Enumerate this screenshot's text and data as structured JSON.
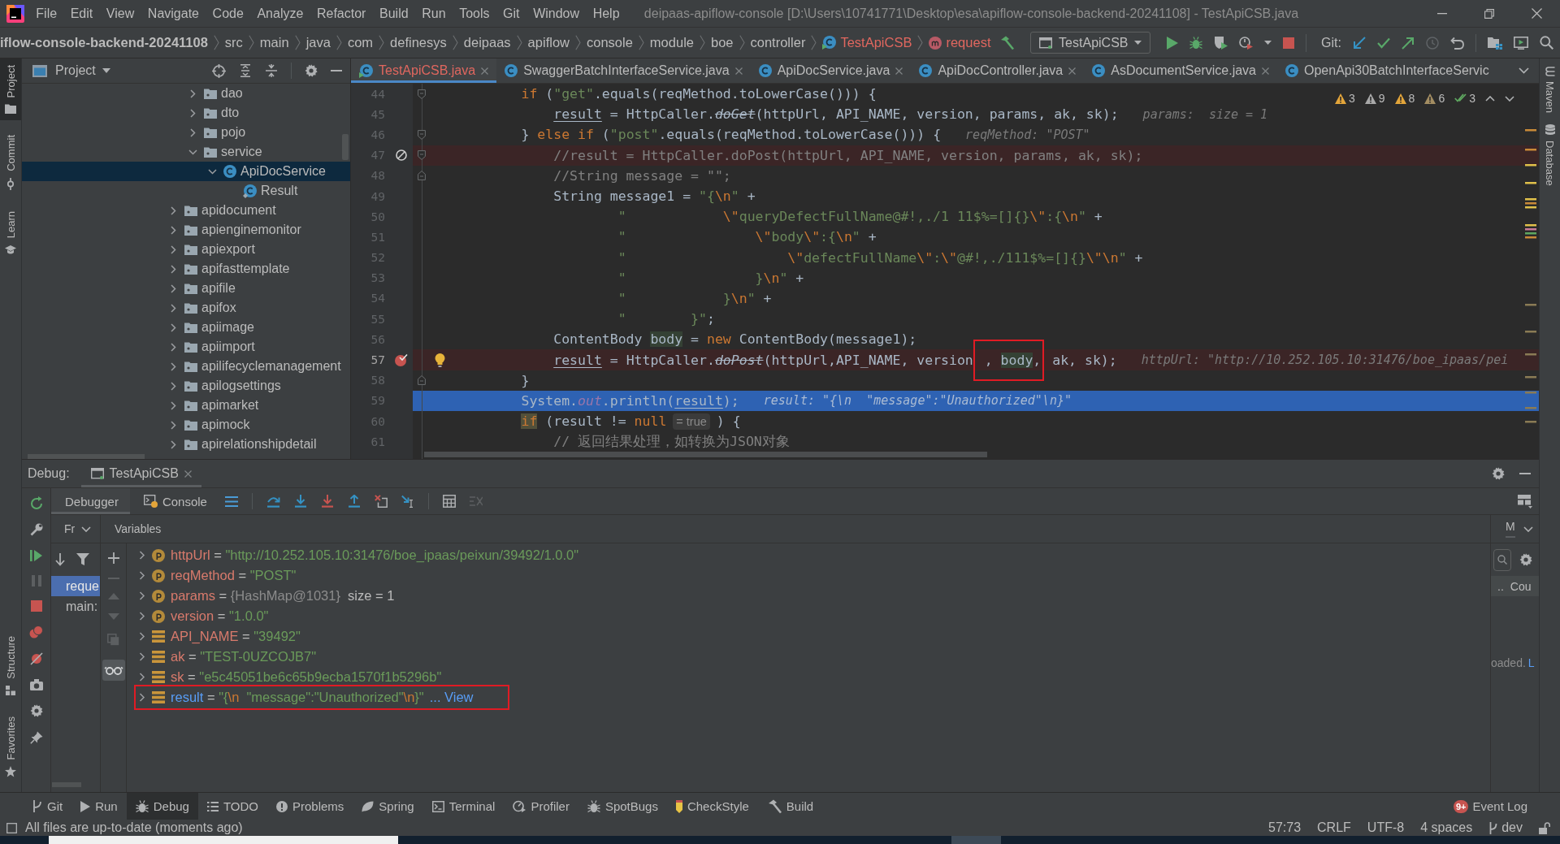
{
  "title_bar": {
    "menu": [
      "File",
      "Edit",
      "View",
      "Navigate",
      "Code",
      "Analyze",
      "Refactor",
      "Build",
      "Run",
      "Tools",
      "Git",
      "Window",
      "Help"
    ],
    "title": "deipaas-apiflow-console [D:\\Users\\10741771\\Desktop\\esa\\apiflow-console-backend-20241108] - TestApiCSB.java"
  },
  "navigation_bar": {
    "breadcrumbs": [
      {
        "label": "iflow-console-backend-20241108",
        "kind": "project"
      },
      {
        "label": "src",
        "kind": "folder"
      },
      {
        "label": "main",
        "kind": "folder"
      },
      {
        "label": "java",
        "kind": "folder"
      },
      {
        "label": "com",
        "kind": "folder"
      },
      {
        "label": "definesys",
        "kind": "folder"
      },
      {
        "label": "deipaas",
        "kind": "folder"
      },
      {
        "label": "apiflow",
        "kind": "folder"
      },
      {
        "label": "console",
        "kind": "folder"
      },
      {
        "label": "module",
        "kind": "folder"
      },
      {
        "label": "boe",
        "kind": "folder"
      },
      {
        "label": "controller",
        "kind": "folder"
      },
      {
        "label": "TestApiCSB",
        "kind": "class"
      },
      {
        "label": "request",
        "kind": "method"
      }
    ],
    "run_configuration": "TestApiCSB",
    "git_label": "Git:"
  },
  "left_stripe": {
    "top": [
      {
        "label": "Project",
        "kind": "project",
        "selected": true
      },
      {
        "label": "Commit",
        "kind": "commit",
        "selected": false
      },
      {
        "label": "Learn",
        "kind": "learn",
        "selected": false
      }
    ],
    "bottom": [
      {
        "label": "Structure",
        "kind": "structure",
        "selected": false
      },
      {
        "label": "Favorites",
        "kind": "favorites",
        "selected": false
      }
    ]
  },
  "project_panel": {
    "title": "Project",
    "tree": [
      {
        "children": [
          {
            "label": "dao",
            "kind": "folder",
            "expanded": false,
            "selected": false
          },
          {
            "label": "dto",
            "kind": "folder",
            "expanded": false,
            "selected": false
          },
          {
            "label": "pojo",
            "kind": "folder",
            "expanded": false,
            "selected": false
          },
          {
            "label": "service",
            "kind": "folder",
            "expanded": true,
            "selected": false,
            "children": [
              {
                "label": "ApiDocService",
                "kind": "class",
                "expanded": true,
                "selected": true,
                "children": [
                  {
                    "label": "Result",
                    "kind": "inner_class",
                    "selected": false
                  }
                ]
              }
            ]
          }
        ]
      },
      {
        "label": "apidocument",
        "kind": "folder",
        "expanded": false,
        "selected": false
      },
      {
        "label": "apienginemonitor",
        "kind": "folder",
        "expanded": false,
        "selected": false
      },
      {
        "label": "apiexport",
        "kind": "folder",
        "expanded": false,
        "selected": false
      },
      {
        "label": "apifasttemplate",
        "kind": "folder",
        "expanded": false,
        "selected": false
      },
      {
        "label": "apifile",
        "kind": "folder",
        "expanded": false,
        "selected": false
      },
      {
        "label": "apifox",
        "kind": "folder",
        "expanded": false,
        "selected": false
      },
      {
        "label": "apiimage",
        "kind": "folder",
        "expanded": false,
        "selected": false
      },
      {
        "label": "apiimport",
        "kind": "folder",
        "expanded": false,
        "selected": false
      },
      {
        "label": "apilifecyclemanagement",
        "kind": "folder",
        "expanded": false,
        "selected": false
      },
      {
        "label": "apilogsettings",
        "kind": "folder",
        "expanded": false,
        "selected": false
      },
      {
        "label": "apimarket",
        "kind": "folder",
        "expanded": false,
        "selected": false
      },
      {
        "label": "apimock",
        "kind": "folder",
        "expanded": false,
        "selected": false
      },
      {
        "label": "apirelationshipdetail",
        "kind": "folder",
        "expanded": false,
        "selected": false
      }
    ]
  },
  "editor": {
    "tabs": [
      {
        "label": "TestApiCSB.java",
        "kind": "runnable_class",
        "selected": true,
        "error": true,
        "closable": true
      },
      {
        "label": "SwaggerBatchInterfaceService.java",
        "kind": "class",
        "selected": false,
        "error": false,
        "closable": true
      },
      {
        "label": "ApiDocService.java",
        "kind": "class",
        "selected": false,
        "error": false,
        "closable": true
      },
      {
        "label": "ApiDocController.java",
        "kind": "class",
        "selected": false,
        "error": false,
        "closable": true
      },
      {
        "label": "AsDocumentService.java",
        "kind": "class",
        "selected": false,
        "error": false,
        "closable": true
      },
      {
        "label": "OpenApi30BatchInterfaceServic",
        "kind": "class",
        "selected": false,
        "error": false,
        "closable": false
      }
    ],
    "inspections": [
      {
        "count": "3",
        "kind": "warning",
        "color": "#e3a53a"
      },
      {
        "count": "9",
        "kind": "warning",
        "color": "#a8a8a8"
      },
      {
        "count": "8",
        "kind": "warning",
        "color": "#e3a53a"
      },
      {
        "count": "6",
        "kind": "warning",
        "color": "#a38d62"
      },
      {
        "count": "3",
        "kind": "typo",
        "color": "#5fa860"
      }
    ],
    "lines": [
      {
        "number": "44",
        "kind": "plain",
        "fold_start": true,
        "fold_end": false,
        "intention": false,
        "segments": [
          {
            "kind": "code",
            "tokens": [
              {
                "text": "        if",
                "kind": "kw"
              },
              {
                "text": " (",
                "kind": "plain"
              },
              {
                "text": "\"get\"",
                "kind": "str"
              },
              {
                "text": ".equals(reqMethod.toLowerCase())) {",
                "kind": "plain"
              }
            ]
          }
        ]
      },
      {
        "number": "45",
        "kind": "plain",
        "fold_start": false,
        "fold_end": false,
        "intention": false,
        "segments": [
          {
            "kind": "code",
            "tokens": [
              {
                "text": "            result",
                "kind": "var"
              },
              {
                "text": " = HttpCaller.",
                "kind": "plain"
              },
              {
                "text": "doGet",
                "kind": "dep"
              },
              {
                "text": "(httpUrl, API_NAME, version, params, ak, sk);",
                "kind": "plain"
              }
            ]
          },
          {
            "kind": "hint",
            "text": "params:  size = 1"
          }
        ]
      },
      {
        "number": "46",
        "kind": "plain",
        "fold_start": true,
        "fold_end": false,
        "intention": false,
        "segments": [
          {
            "kind": "code",
            "tokens": [
              {
                "text": "        } ",
                "kind": "plain"
              },
              {
                "text": "else if",
                "kind": "kw"
              },
              {
                "text": " (",
                "kind": "plain"
              },
              {
                "text": "\"post\"",
                "kind": "str"
              },
              {
                "text": ".equals(reqMethod.toLowerCase())) {",
                "kind": "plain"
              }
            ]
          },
          {
            "kind": "hint",
            "text": "reqMethod: \"POST\""
          }
        ]
      },
      {
        "number": "47",
        "kind": "muted_breakpoint",
        "fold_start": true,
        "fold_end": false,
        "intention": false,
        "segments": [
          {
            "kind": "code",
            "tokens": [
              {
                "text": "            //result = HttpCaller.doPost(httpUrl, API_NAME, version, params, ak, sk);",
                "kind": "comment"
              }
            ]
          }
        ]
      },
      {
        "number": "48",
        "kind": "plain",
        "fold_start": false,
        "fold_end": true,
        "intention": false,
        "segments": [
          {
            "kind": "code",
            "tokens": [
              {
                "text": "            //String message = \"\";",
                "kind": "comment"
              }
            ]
          }
        ]
      },
      {
        "number": "49",
        "kind": "plain",
        "fold_start": false,
        "fold_end": false,
        "intention": false,
        "segments": [
          {
            "kind": "code",
            "tokens": [
              {
                "text": "            String message1 = ",
                "kind": "plain"
              },
              {
                "text": "\"{",
                "kind": "str"
              },
              {
                "text": "\\n",
                "kind": "esc"
              },
              {
                "text": "\"",
                "kind": "str"
              },
              {
                "text": " +",
                "kind": "plain"
              }
            ]
          }
        ]
      },
      {
        "number": "50",
        "kind": "plain",
        "fold_start": false,
        "fold_end": false,
        "intention": false,
        "segments": [
          {
            "kind": "code",
            "tokens": [
              {
                "text": "                    \"            ",
                "kind": "str"
              },
              {
                "text": "\\\"",
                "kind": "esc"
              },
              {
                "text": "queryDefectFullName@#!,./1 11$%=[]{}",
                "kind": "str"
              },
              {
                "text": "\\\"",
                "kind": "esc"
              },
              {
                "text": ":{",
                "kind": "str"
              },
              {
                "text": "\\n",
                "kind": "esc"
              },
              {
                "text": "\"",
                "kind": "str"
              },
              {
                "text": " +",
                "kind": "plain"
              }
            ]
          }
        ]
      },
      {
        "number": "51",
        "kind": "plain",
        "fold_start": false,
        "fold_end": false,
        "intention": false,
        "segments": [
          {
            "kind": "code",
            "tokens": [
              {
                "text": "                    \"                ",
                "kind": "str"
              },
              {
                "text": "\\\"",
                "kind": "esc"
              },
              {
                "text": "body",
                "kind": "str"
              },
              {
                "text": "\\\"",
                "kind": "esc"
              },
              {
                "text": ":{",
                "kind": "str"
              },
              {
                "text": "\\n",
                "kind": "esc"
              },
              {
                "text": "\"",
                "kind": "str"
              },
              {
                "text": " +",
                "kind": "plain"
              }
            ]
          }
        ]
      },
      {
        "number": "52",
        "kind": "plain",
        "fold_start": false,
        "fold_end": false,
        "intention": false,
        "segments": [
          {
            "kind": "code",
            "tokens": [
              {
                "text": "                    \"                    ",
                "kind": "str"
              },
              {
                "text": "\\\"",
                "kind": "esc"
              },
              {
                "text": "defectFullName",
                "kind": "str"
              },
              {
                "text": "\\\"",
                "kind": "esc"
              },
              {
                "text": ":",
                "kind": "str"
              },
              {
                "text": "\\\"",
                "kind": "esc"
              },
              {
                "text": "@#!,./111$%=[]{}",
                "kind": "str"
              },
              {
                "text": "\\\"\\n",
                "kind": "esc"
              },
              {
                "text": "\"",
                "kind": "str"
              },
              {
                "text": " +",
                "kind": "plain"
              }
            ]
          }
        ]
      },
      {
        "number": "53",
        "kind": "plain",
        "fold_start": false,
        "fold_end": false,
        "intention": false,
        "segments": [
          {
            "kind": "code",
            "tokens": [
              {
                "text": "                    \"                }",
                "kind": "str"
              },
              {
                "text": "\\n",
                "kind": "esc"
              },
              {
                "text": "\"",
                "kind": "str"
              },
              {
                "text": " +",
                "kind": "plain"
              }
            ]
          }
        ]
      },
      {
        "number": "54",
        "kind": "plain",
        "fold_start": false,
        "fold_end": false,
        "intention": false,
        "segments": [
          {
            "kind": "code",
            "tokens": [
              {
                "text": "                    \"            }",
                "kind": "str"
              },
              {
                "text": "\\n",
                "kind": "esc"
              },
              {
                "text": "\"",
                "kind": "str"
              },
              {
                "text": " +",
                "kind": "plain"
              }
            ]
          }
        ]
      },
      {
        "number": "55",
        "kind": "plain",
        "fold_start": false,
        "fold_end": false,
        "intention": false,
        "segments": [
          {
            "kind": "code",
            "tokens": [
              {
                "text": "                    \"        }\"",
                "kind": "str"
              },
              {
                "text": ";",
                "kind": "plain"
              }
            ]
          }
        ]
      },
      {
        "number": "56",
        "kind": "plain",
        "fold_start": false,
        "fold_end": false,
        "intention": false,
        "segments": [
          {
            "kind": "code",
            "tokens": [
              {
                "text": "            ContentBody ",
                "kind": "plain"
              },
              {
                "text": "body",
                "kind": "usage"
              },
              {
                "text": " = ",
                "kind": "plain"
              },
              {
                "text": "new",
                "kind": "kw"
              },
              {
                "text": " ContentBody(message1);",
                "kind": "plain"
              }
            ]
          }
        ]
      },
      {
        "number": "57",
        "kind": "breakpoint",
        "fold_start": false,
        "fold_end": false,
        "intention": true,
        "segments": [
          {
            "kind": "code",
            "tokens": [
              {
                "text": "            result",
                "kind": "var"
              },
              {
                "text": " = HttpCaller.",
                "kind": "plain"
              },
              {
                "text": "doPost",
                "kind": "dep"
              },
              {
                "text": "(httpUrl,API_NAME, version",
                "kind": "plain"
              }
            ]
          },
          {
            "kind": "annotated",
            "tokens": [
              {
                "text": " , ",
                "kind": "plain"
              },
              {
                "text": "body",
                "kind": "usage"
              },
              {
                "text": ",",
                "kind": "plain"
              }
            ]
          },
          {
            "kind": "code",
            "tokens": [
              {
                "text": " ak, sk);",
                "kind": "plain"
              }
            ]
          },
          {
            "kind": "hint",
            "text": "httpUrl: \"http://10.252.105.10:31476/boe_ipaas/pei"
          }
        ]
      },
      {
        "number": "58",
        "kind": "plain",
        "fold_start": false,
        "fold_end": true,
        "intention": false,
        "segments": [
          {
            "kind": "code",
            "tokens": [
              {
                "text": "        }",
                "kind": "plain"
              }
            ]
          }
        ]
      },
      {
        "number": "59",
        "kind": "execution",
        "fold_start": false,
        "fold_end": false,
        "intention": false,
        "segments": [
          {
            "kind": "code",
            "tokens": [
              {
                "text": "        System.",
                "kind": "plain"
              },
              {
                "text": "out",
                "kind": "static"
              },
              {
                "text": ".println(",
                "kind": "plain"
              },
              {
                "text": "result",
                "kind": "var"
              },
              {
                "text": ");",
                "kind": "plain"
              }
            ]
          },
          {
            "kind": "hint",
            "text": "result: \"{\\n  \"message\":\"Unauthorized\"\\n}\""
          }
        ]
      },
      {
        "number": "60",
        "kind": "plain",
        "fold_start": false,
        "fold_end": false,
        "intention": false,
        "segments": [
          {
            "kind": "code",
            "tokens": [
              {
                "text": "        if",
                "kind": "kwmark"
              },
              {
                "text": " (result != ",
                "kind": "plain"
              },
              {
                "text": "null",
                "kind": "kw"
              }
            ]
          },
          {
            "kind": "inline_hint",
            "text": "= true"
          },
          {
            "kind": "code",
            "tokens": [
              {
                "text": ") {",
                "kind": "plain"
              }
            ]
          }
        ]
      },
      {
        "number": "61",
        "kind": "plain",
        "fold_start": false,
        "fold_end": false,
        "intention": false,
        "segments": [
          {
            "kind": "code",
            "tokens": [
              {
                "text": "            // 返回结果处理，如转换为JSON对象",
                "kind": "comment"
              }
            ]
          }
        ]
      }
    ]
  },
  "right_stripe": [
    {
      "label": "Maven",
      "kind": "maven"
    },
    {
      "label": "Database",
      "kind": "database"
    }
  ],
  "debug": {
    "label": "Debug:",
    "session_tab": "TestApiCSB",
    "tabs": [
      {
        "label": "Debugger",
        "kind": "debugger",
        "selected": true
      },
      {
        "label": "Console",
        "kind": "console",
        "selected": false
      }
    ],
    "frames": {
      "header": "Fr",
      "items": [
        {
          "label": "reque",
          "selected": true
        },
        {
          "label": "main:",
          "selected": false
        }
      ]
    },
    "variables": {
      "header": "Variables",
      "items": [
        {
          "kind": "parameter",
          "expanded": false,
          "annotated": false,
          "tokens": [
            {
              "text": "httpUrl",
              "kind": "name"
            },
            {
              "text": " = ",
              "kind": "plain"
            },
            {
              "text": "\"http://10.252.105.10:31476/boe_ipaas/peixun/39492/1.0.0\"",
              "kind": "string"
            }
          ]
        },
        {
          "kind": "parameter",
          "expanded": false,
          "annotated": false,
          "tokens": [
            {
              "text": "reqMethod",
              "kind": "name"
            },
            {
              "text": " = ",
              "kind": "plain"
            },
            {
              "text": "\"POST\"",
              "kind": "string"
            }
          ]
        },
        {
          "kind": "parameter",
          "expanded": false,
          "annotated": false,
          "tokens": [
            {
              "text": "params",
              "kind": "name"
            },
            {
              "text": " = ",
              "kind": "plain"
            },
            {
              "text": "{HashMap@1031}",
              "kind": "ref"
            },
            {
              "text": "  size = 1",
              "kind": "plain"
            }
          ]
        },
        {
          "kind": "parameter",
          "expanded": false,
          "annotated": false,
          "tokens": [
            {
              "text": "version",
              "kind": "name"
            },
            {
              "text": " = ",
              "kind": "plain"
            },
            {
              "text": "\"1.0.0\"",
              "kind": "string"
            }
          ]
        },
        {
          "kind": "local",
          "expanded": false,
          "annotated": false,
          "tokens": [
            {
              "text": "API_NAME",
              "kind": "name"
            },
            {
              "text": " = ",
              "kind": "plain"
            },
            {
              "text": "\"39492\"",
              "kind": "string"
            }
          ]
        },
        {
          "kind": "local",
          "expanded": false,
          "annotated": false,
          "tokens": [
            {
              "text": "ak",
              "kind": "name"
            },
            {
              "text": " = ",
              "kind": "plain"
            },
            {
              "text": "\"TEST-0UZCOJB7\"",
              "kind": "string"
            }
          ]
        },
        {
          "kind": "local",
          "expanded": false,
          "annotated": false,
          "tokens": [
            {
              "text": "sk",
              "kind": "name"
            },
            {
              "text": " = ",
              "kind": "plain"
            },
            {
              "text": "\"e5c45051be6c65b9ecba1570f1b5296b\"",
              "kind": "string"
            }
          ]
        },
        {
          "kind": "local",
          "expanded": false,
          "annotated": true,
          "tokens": [
            {
              "text": "result",
              "kind": "changed_name"
            },
            {
              "text": " = ",
              "kind": "plain"
            },
            {
              "text": "\"{",
              "kind": "string"
            },
            {
              "text": "\\n",
              "kind": "escape"
            },
            {
              "text": "  \"message\":\"Unauthorized\"",
              "kind": "string"
            },
            {
              "text": "\\n",
              "kind": "escape"
            },
            {
              "text": "}\"",
              "kind": "string"
            }
          ],
          "link": "... View"
        }
      ]
    },
    "memory": {
      "tab": "M",
      "columns": [
        "..",
        "Cou"
      ],
      "message": "oaded.",
      "link": "L"
    }
  },
  "tool_windows": {
    "items": [
      {
        "label": "Git",
        "kind": "git",
        "selected": false
      },
      {
        "label": "Run",
        "kind": "run",
        "selected": false
      },
      {
        "label": "Debug",
        "kind": "debug",
        "selected": true
      },
      {
        "label": "TODO",
        "kind": "todo",
        "selected": false
      },
      {
        "label": "Problems",
        "kind": "problems",
        "selected": false
      },
      {
        "label": "Spring",
        "kind": "spring",
        "selected": false
      },
      {
        "label": "Terminal",
        "kind": "terminal",
        "selected": false
      },
      {
        "label": "Profiler",
        "kind": "profiler",
        "selected": false
      },
      {
        "label": "SpotBugs",
        "kind": "spotbugs",
        "selected": false
      },
      {
        "label": "CheckStyle",
        "kind": "checkstyle",
        "selected": false
      },
      {
        "label": "Build",
        "kind": "build",
        "selected": false
      }
    ],
    "event_log": {
      "label": "Event Log",
      "badge": "9+"
    }
  },
  "status_bar": {
    "message": "All files are up-to-date (moments ago)",
    "position": "57:73",
    "line_separator": "CRLF",
    "encoding": "UTF-8",
    "indent": "4 spaces",
    "branch": "dev"
  }
}
